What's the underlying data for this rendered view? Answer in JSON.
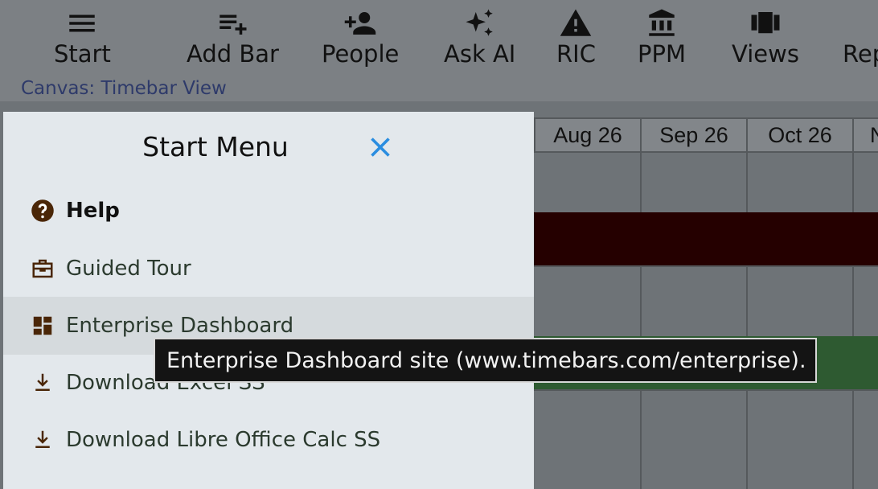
{
  "toolbar": {
    "items": [
      {
        "label": "Start",
        "icon": "hamburger-menu-icon"
      },
      {
        "label": "Add Bar",
        "icon": "playlist-add-icon"
      },
      {
        "label": "People",
        "icon": "person-add-icon"
      },
      {
        "label": "Ask AI",
        "icon": "sparkles-icon"
      },
      {
        "label": "RIC",
        "icon": "warning-icon"
      },
      {
        "label": "PPM",
        "icon": "bank-icon"
      },
      {
        "label": "Views",
        "icon": "view-carousel-icon"
      },
      {
        "label": "Rep",
        "icon": "report-icon"
      }
    ],
    "canvas_label": "Canvas: Timebar View"
  },
  "timeline": {
    "months": [
      "Aug 26",
      "Sep 26",
      "Oct 26",
      "N"
    ],
    "colors": {
      "dark_bar": "#250000",
      "green_bar": "#2e5a31"
    }
  },
  "start_menu": {
    "title": "Start Menu",
    "close_icon": "close-icon",
    "accent": "#2a8de0",
    "items": [
      {
        "label": "Help",
        "icon": "help-circle-icon",
        "bold": true
      },
      {
        "label": "Guided Tour",
        "icon": "briefcase-icon"
      },
      {
        "label": "Enterprise Dashboard",
        "icon": "dashboard-icon",
        "hovered": true
      },
      {
        "label": "Download Excel SS",
        "icon": "download-icon"
      },
      {
        "label": "Download Libre Office Calc SS",
        "icon": "download-icon"
      }
    ]
  },
  "tooltip": {
    "text": "Enterprise Dashboard site (www.timebars.com/enterprise)."
  }
}
